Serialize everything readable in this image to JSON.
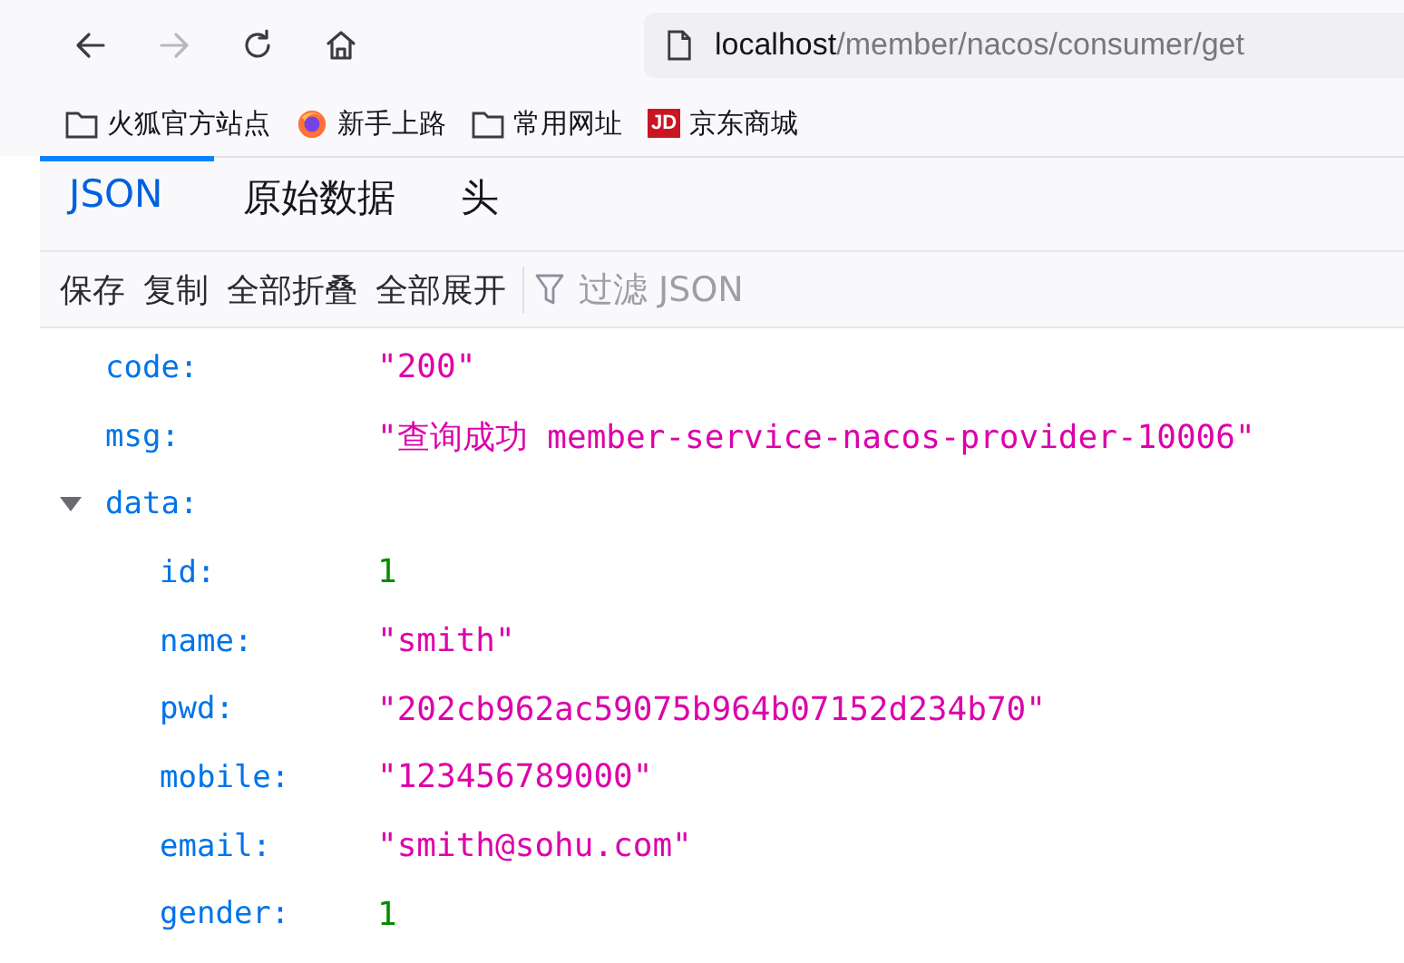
{
  "nav_buttons": [
    {
      "kind": "back",
      "disabled": false
    },
    {
      "kind": "forward",
      "disabled": true
    },
    {
      "kind": "reload",
      "disabled": false
    },
    {
      "kind": "home",
      "disabled": false
    }
  ],
  "url": {
    "host": "localhost",
    "path": "/member/nacos/consumer/get"
  },
  "bookmarks": [
    {
      "kind": "folder",
      "label": "火狐官方站点"
    },
    {
      "kind": "firefox",
      "label": "新手上路"
    },
    {
      "kind": "folder",
      "label": "常用网址"
    },
    {
      "kind": "jd",
      "logo_text": "JD",
      "label": "京东商城"
    }
  ],
  "tabs": [
    {
      "label": "JSON",
      "selected": true
    },
    {
      "label": "原始数据",
      "selected": false
    },
    {
      "label": "头",
      "selected": false
    }
  ],
  "toolbar": {
    "buttons": [
      "保存",
      "复制",
      "全部折叠",
      "全部展开"
    ],
    "filter_placeholder": "过滤 JSON"
  },
  "json": [
    {
      "key": "code:",
      "kind": "string",
      "value": "\"200\""
    },
    {
      "key": "msg:",
      "kind": "string",
      "value": "\"查询成功 member-service-nacos-provider-10006\""
    },
    {
      "key": "data:",
      "kind": "object",
      "expanded": true,
      "children": [
        {
          "key": "id:",
          "kind": "number",
          "value": "1"
        },
        {
          "key": "name:",
          "kind": "string",
          "value": "\"smith\""
        },
        {
          "key": "pwd:",
          "kind": "string",
          "value": "\"202cb962ac59075b964b07152d234b70\""
        },
        {
          "key": "mobile:",
          "kind": "string",
          "value": "\"123456789000\""
        },
        {
          "key": "email:",
          "kind": "string",
          "value": "\"smith@sohu.com\""
        },
        {
          "key": "gender:",
          "kind": "number",
          "value": "1"
        }
      ]
    }
  ]
}
